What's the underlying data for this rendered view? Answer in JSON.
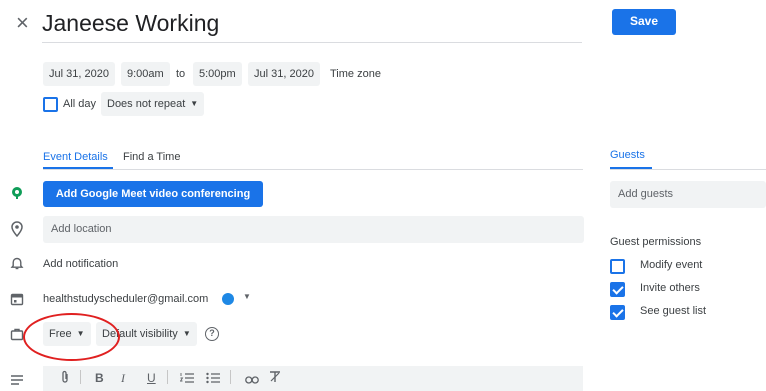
{
  "header": {
    "close_symbol": "×",
    "title": "Janeese Working",
    "save_label": "Save"
  },
  "datetime": {
    "start_date": "Jul 31, 2020",
    "start_time": "9:00am",
    "to_label": "to",
    "end_time": "5:00pm",
    "end_date": "Jul 31, 2020",
    "time_zone_label": "Time zone",
    "all_day_label": "All day",
    "all_day_checked": false,
    "repeat_label": "Does not repeat"
  },
  "tabs": {
    "event_details": "Event Details",
    "find_a_time": "Find a Time"
  },
  "details": {
    "meet_button_label": "Add Google Meet video conferencing",
    "location_placeholder": "Add location",
    "notification_label": "Add notification",
    "calendar_owner": "healthstudyscheduler@gmail.com",
    "calendar_color": "#1e88e5",
    "availability": "Free",
    "visibility": "Default visibility",
    "help_symbol": "?"
  },
  "toolbar": {
    "attach_icon": "paperclip-icon",
    "bold": "B",
    "italic": "I",
    "underline": "U",
    "numbered_list_icon": "numbered-list-icon",
    "bullet_list_icon": "bulleted-list-icon",
    "link_icon": "link-icon",
    "clear_format_icon": "clear-formatting-icon"
  },
  "guests": {
    "tab_label": "Guests",
    "add_placeholder": "Add guests",
    "permissions_title": "Guest permissions",
    "permissions": [
      {
        "label": "Modify event",
        "checked": false
      },
      {
        "label": "Invite others",
        "checked": true
      },
      {
        "label": "See guest list",
        "checked": true
      }
    ]
  },
  "colors": {
    "accent": "#1a73e8",
    "annotation_circle": "#e02020"
  }
}
